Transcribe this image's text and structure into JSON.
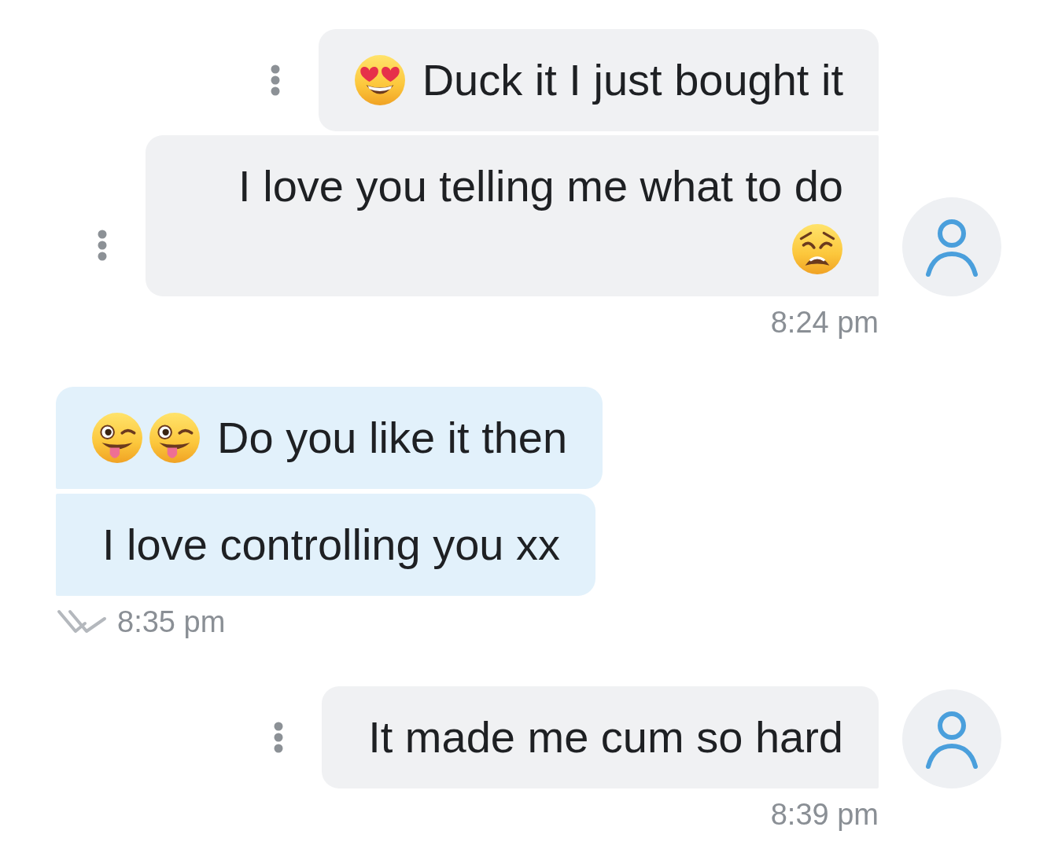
{
  "groups": [
    {
      "kind": "incoming",
      "messages": [
        {
          "text": "Duck it I just bought it",
          "emojis": [
            {
              "kind": "heart_eyes"
            }
          ]
        },
        {
          "text": "I love you telling me what to do",
          "emojis": [
            {
              "kind": "weary"
            }
          ]
        }
      ],
      "time": "8:24 pm"
    },
    {
      "kind": "outgoing",
      "messages": [
        {
          "text": "Do you like it then",
          "emojis": [
            {
              "kind": "winking_tongue"
            },
            {
              "kind": "winking_tongue"
            }
          ]
        },
        {
          "text": "I love controlling you xx"
        }
      ],
      "time": "8:35 pm",
      "delivered": true
    },
    {
      "kind": "incoming",
      "messages": [
        {
          "text": "It made me cum so hard"
        }
      ],
      "time": "8:39 pm"
    }
  ]
}
